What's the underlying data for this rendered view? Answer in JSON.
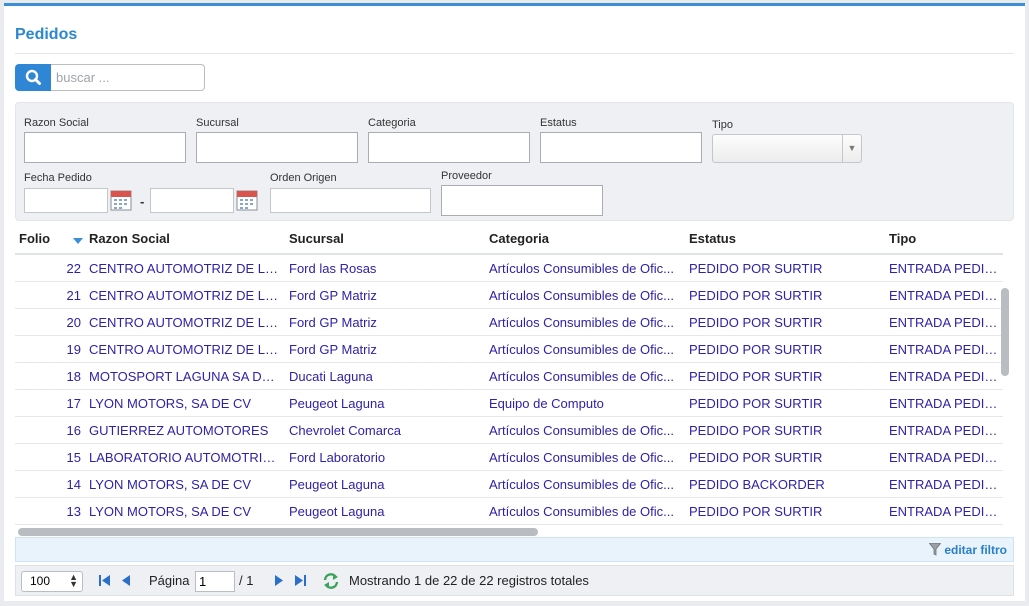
{
  "page": {
    "title": "Pedidos"
  },
  "search": {
    "placeholder": "buscar ..."
  },
  "filters": {
    "razon_social": "Razon Social",
    "sucursal": "Sucursal",
    "categoria": "Categoria",
    "estatus": "Estatus",
    "tipo": "Tipo",
    "fecha_pedido": "Fecha Pedido",
    "orden_origen": "Orden Origen",
    "proveedor": "Proveedor",
    "date_separator": "-"
  },
  "table": {
    "columns": [
      "Folio",
      "Razon Social",
      "Sucursal",
      "Categoria",
      "Estatus",
      "Tipo"
    ],
    "rows": [
      [
        "22",
        "CENTRO AUTOMOTRIZ DE LA ...",
        "Ford las Rosas",
        "Artículos Consumibles de Ofic...",
        "PEDIDO POR SURTIR",
        "ENTRADA PEDIDO"
      ],
      [
        "21",
        "CENTRO AUTOMOTRIZ DE LA ...",
        "Ford GP Matriz",
        "Artículos Consumibles de Ofic...",
        "PEDIDO POR SURTIR",
        "ENTRADA PEDIDO"
      ],
      [
        "20",
        "CENTRO AUTOMOTRIZ DE LA ...",
        "Ford GP Matriz",
        "Artículos Consumibles de Ofic...",
        "PEDIDO POR SURTIR",
        "ENTRADA PEDIDO"
      ],
      [
        "19",
        "CENTRO AUTOMOTRIZ DE LA ...",
        "Ford GP Matriz",
        "Artículos Consumibles de Ofic...",
        "PEDIDO POR SURTIR",
        "ENTRADA PEDIDO"
      ],
      [
        "18",
        "MOTOSPORT LAGUNA SA DE ...",
        "Ducati Laguna",
        "Artículos Consumibles de Ofic...",
        "PEDIDO POR SURTIR",
        "ENTRADA PEDIDO"
      ],
      [
        "17",
        "LYON MOTORS, SA DE CV",
        "Peugeot Laguna",
        "Equipo de Computo",
        "PEDIDO POR SURTIR",
        "ENTRADA PEDIDO"
      ],
      [
        "16",
        "GUTIERREZ AUTOMOTORES",
        "Chevrolet Comarca",
        "Artículos Consumibles de Ofic...",
        "PEDIDO POR SURTIR",
        "ENTRADA PEDIDO"
      ],
      [
        "15",
        "LABORATORIO AUTOMOTRIZ ...",
        "Ford Laboratorio",
        "Artículos Consumibles de Ofic...",
        "PEDIDO POR SURTIR",
        "ENTRADA PEDIDO"
      ],
      [
        "14",
        "LYON MOTORS, SA DE CV",
        "Peugeot Laguna",
        "Artículos Consumibles de Ofic...",
        "PEDIDO BACKORDER",
        "ENTRADA PEDIDO"
      ],
      [
        "13",
        "LYON MOTORS, SA DE CV",
        "Peugeot Laguna",
        "Artículos Consumibles de Ofic...",
        "PEDIDO POR SURTIR",
        "ENTRADA PEDIDO"
      ]
    ]
  },
  "filter_bar": {
    "edit_label": "editar filtro"
  },
  "pager": {
    "page_size": "100",
    "page_label": "Página",
    "page_value": "1",
    "of_total": "/ 1",
    "summary": "Mostrando 1 de 22 de 22 registros totales"
  },
  "colors": {
    "accent": "#2f86d4",
    "link": "#2e22a8",
    "title": "#2b87cf"
  },
  "icons": [
    "search-icon",
    "calendar-icon",
    "chevron-down-icon",
    "sort-desc-icon",
    "funnel-icon",
    "first-page-icon",
    "prev-page-icon",
    "next-page-icon",
    "last-page-icon",
    "refresh-icon"
  ]
}
